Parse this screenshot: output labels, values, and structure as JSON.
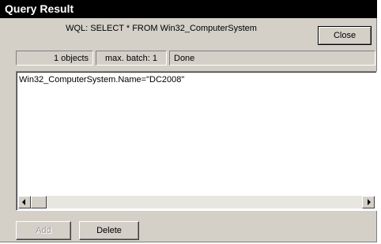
{
  "window": {
    "title": "Query Result"
  },
  "query": {
    "text": "WQL: SELECT * FROM Win32_ComputerSystem"
  },
  "buttons": {
    "close": "Close",
    "add": "Add",
    "delete": "Delete"
  },
  "status": {
    "objects": "1 objects",
    "batch": "max. batch: 1",
    "state": "Done"
  },
  "results": {
    "items": [
      "Win32_ComputerSystem.Name=\"DC2008\""
    ]
  },
  "icons": {
    "scroll_left": "scroll-left-arrow-icon",
    "scroll_right": "scroll-right-arrow-icon"
  }
}
